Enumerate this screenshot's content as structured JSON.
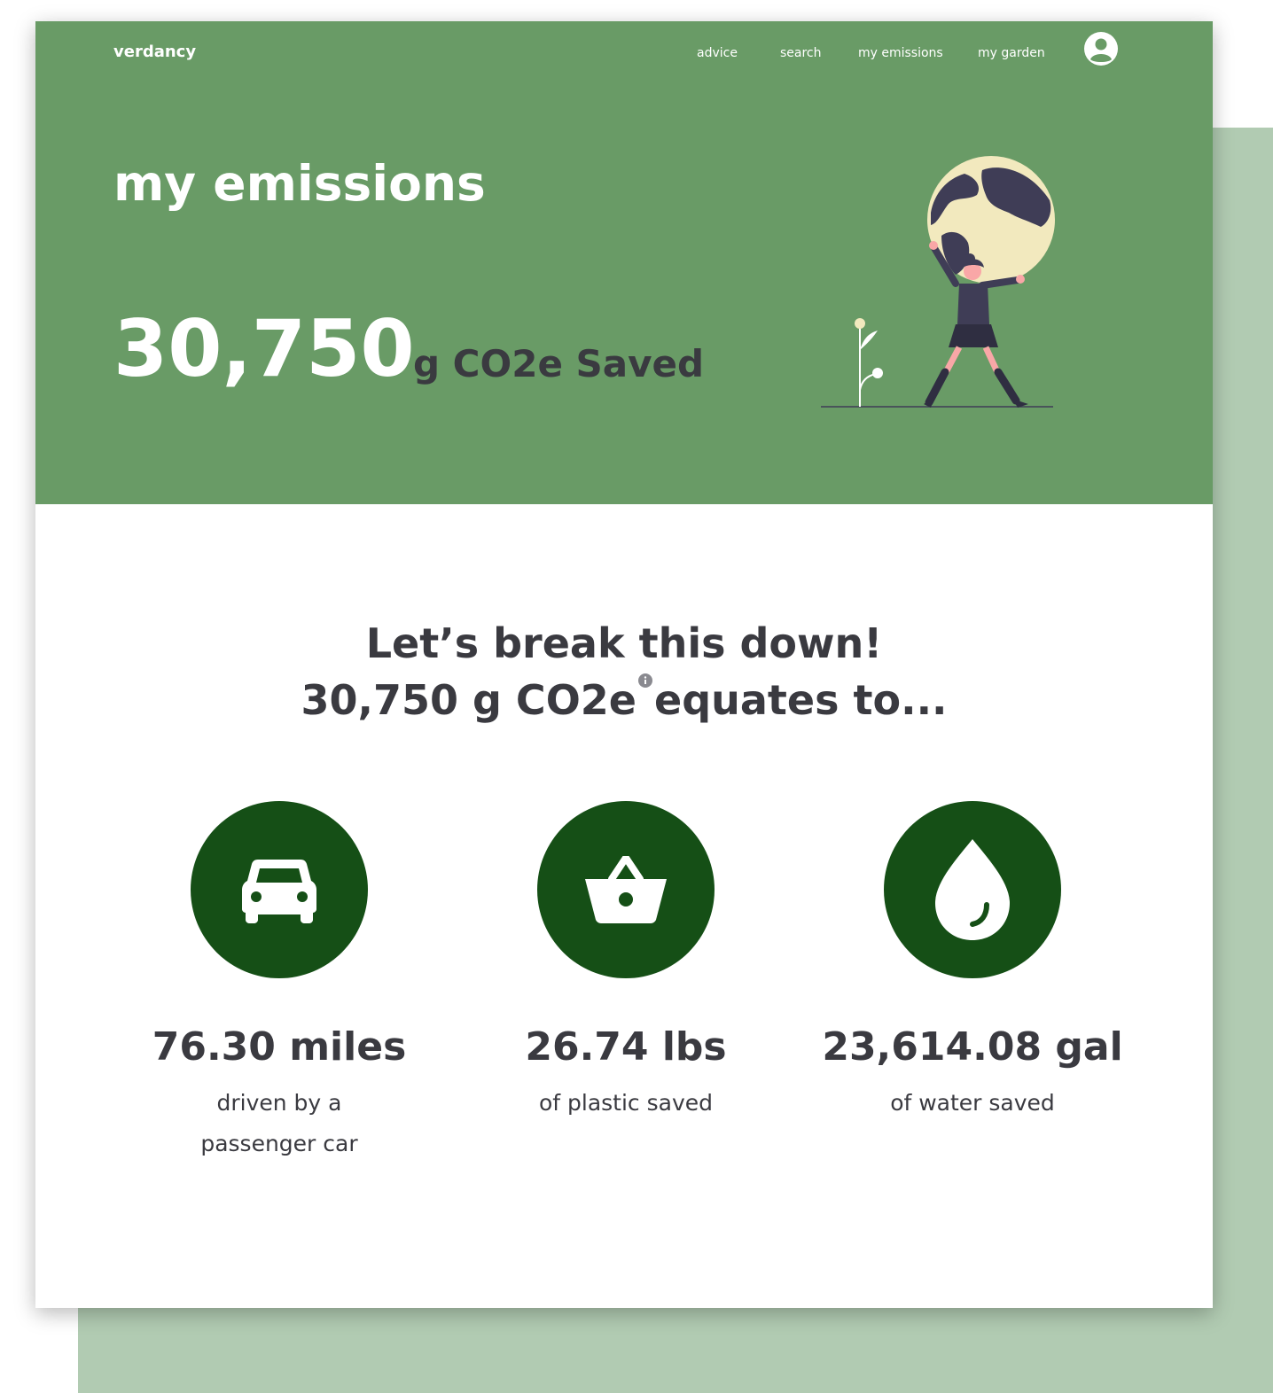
{
  "app": {
    "brand": "verdancy"
  },
  "nav": {
    "items": [
      {
        "label": "advice"
      },
      {
        "label": "search"
      },
      {
        "label": "my emissions"
      },
      {
        "label": "my garden"
      }
    ],
    "avatar_icon": "user-circle-icon"
  },
  "hero": {
    "title": "my emissions",
    "value": "30,750",
    "unit_label": "g CO2e Saved",
    "illustration": "person-holding-globe"
  },
  "breakdown": {
    "heading": "Let’s break this down!",
    "sub_prefix": "30,750 g CO2e",
    "sub_suffix": "equates to...",
    "info_icon": "info-icon"
  },
  "stats": [
    {
      "icon": "car-icon",
      "value": "76.30 miles",
      "description": "driven by a passenger car"
    },
    {
      "icon": "basket-icon",
      "value": "26.74 lbs",
      "description": "of plastic saved"
    },
    {
      "icon": "water-drop-icon",
      "value": "23,614.08 gal",
      "description": "of water saved"
    }
  ],
  "colors": {
    "hero_green": "#699b66",
    "dark_green": "#154f16",
    "backdrop_green": "#b1cbb2",
    "text_dark": "#3a3a40"
  }
}
